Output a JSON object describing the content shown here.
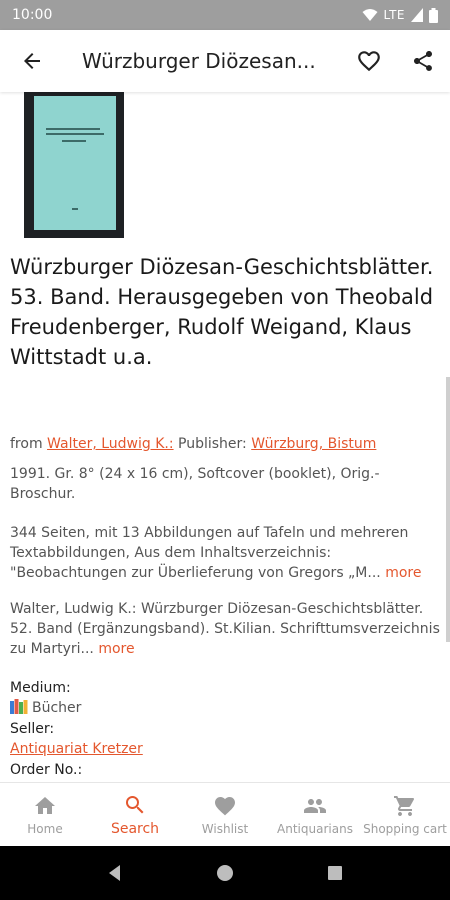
{
  "status_bar": {
    "time": "10:00",
    "network": "LTE"
  },
  "app_bar": {
    "title": "Würzburger Diözesan..."
  },
  "book": {
    "title": "Würzburger Diözesan-Geschichtsblätter. 53. Band. Herausgegeben von Theobald Freudenberger, Rudolf Weigand, Klaus Wittstadt u.a."
  },
  "details": {
    "from_label": "from",
    "author_link": "Walter, Ludwig K.:",
    "publisher_label": "Publisher:",
    "publisher_link": "Würzburg, Bistum",
    "edition": "1991. Gr. 8° (24 x 16 cm), Softcover (booklet), Orig.-Broschur.",
    "description": "344 Seiten, mit 13 Abbildungen auf Tafeln und mehreren Textabbildungen, Aus dem Inhaltsverzeichnis: \"Beobachtungen zur Überlieferung von Gregors „M...",
    "description_more": "more",
    "note": "Walter, Ludwig K.: Würzburger Diözesan-Geschichtsblätter. 52. Band (Ergänzungsband). St.Kilian. Schrifttumsverzeichnis zu Martyri...",
    "note_more": "more",
    "medium_label": "Medium:",
    "medium_value": "Bücher",
    "seller_label": "Seller:",
    "seller_link": "Antiquariat Kretzer",
    "order_label": "Order No.:"
  },
  "bottom_nav": {
    "items": [
      {
        "label": "Home",
        "icon": "home-icon"
      },
      {
        "label": "Search",
        "icon": "search-icon"
      },
      {
        "label": "Wishlist",
        "icon": "heart-icon"
      },
      {
        "label": "Antiquarians",
        "icon": "people-icon"
      },
      {
        "label": "Shopping cart",
        "icon": "cart-icon"
      }
    ],
    "active": "Search"
  },
  "colors": {
    "accent": "#e4572e",
    "status_bar": "#9e9e9e",
    "cover": "#8fd4cf"
  }
}
